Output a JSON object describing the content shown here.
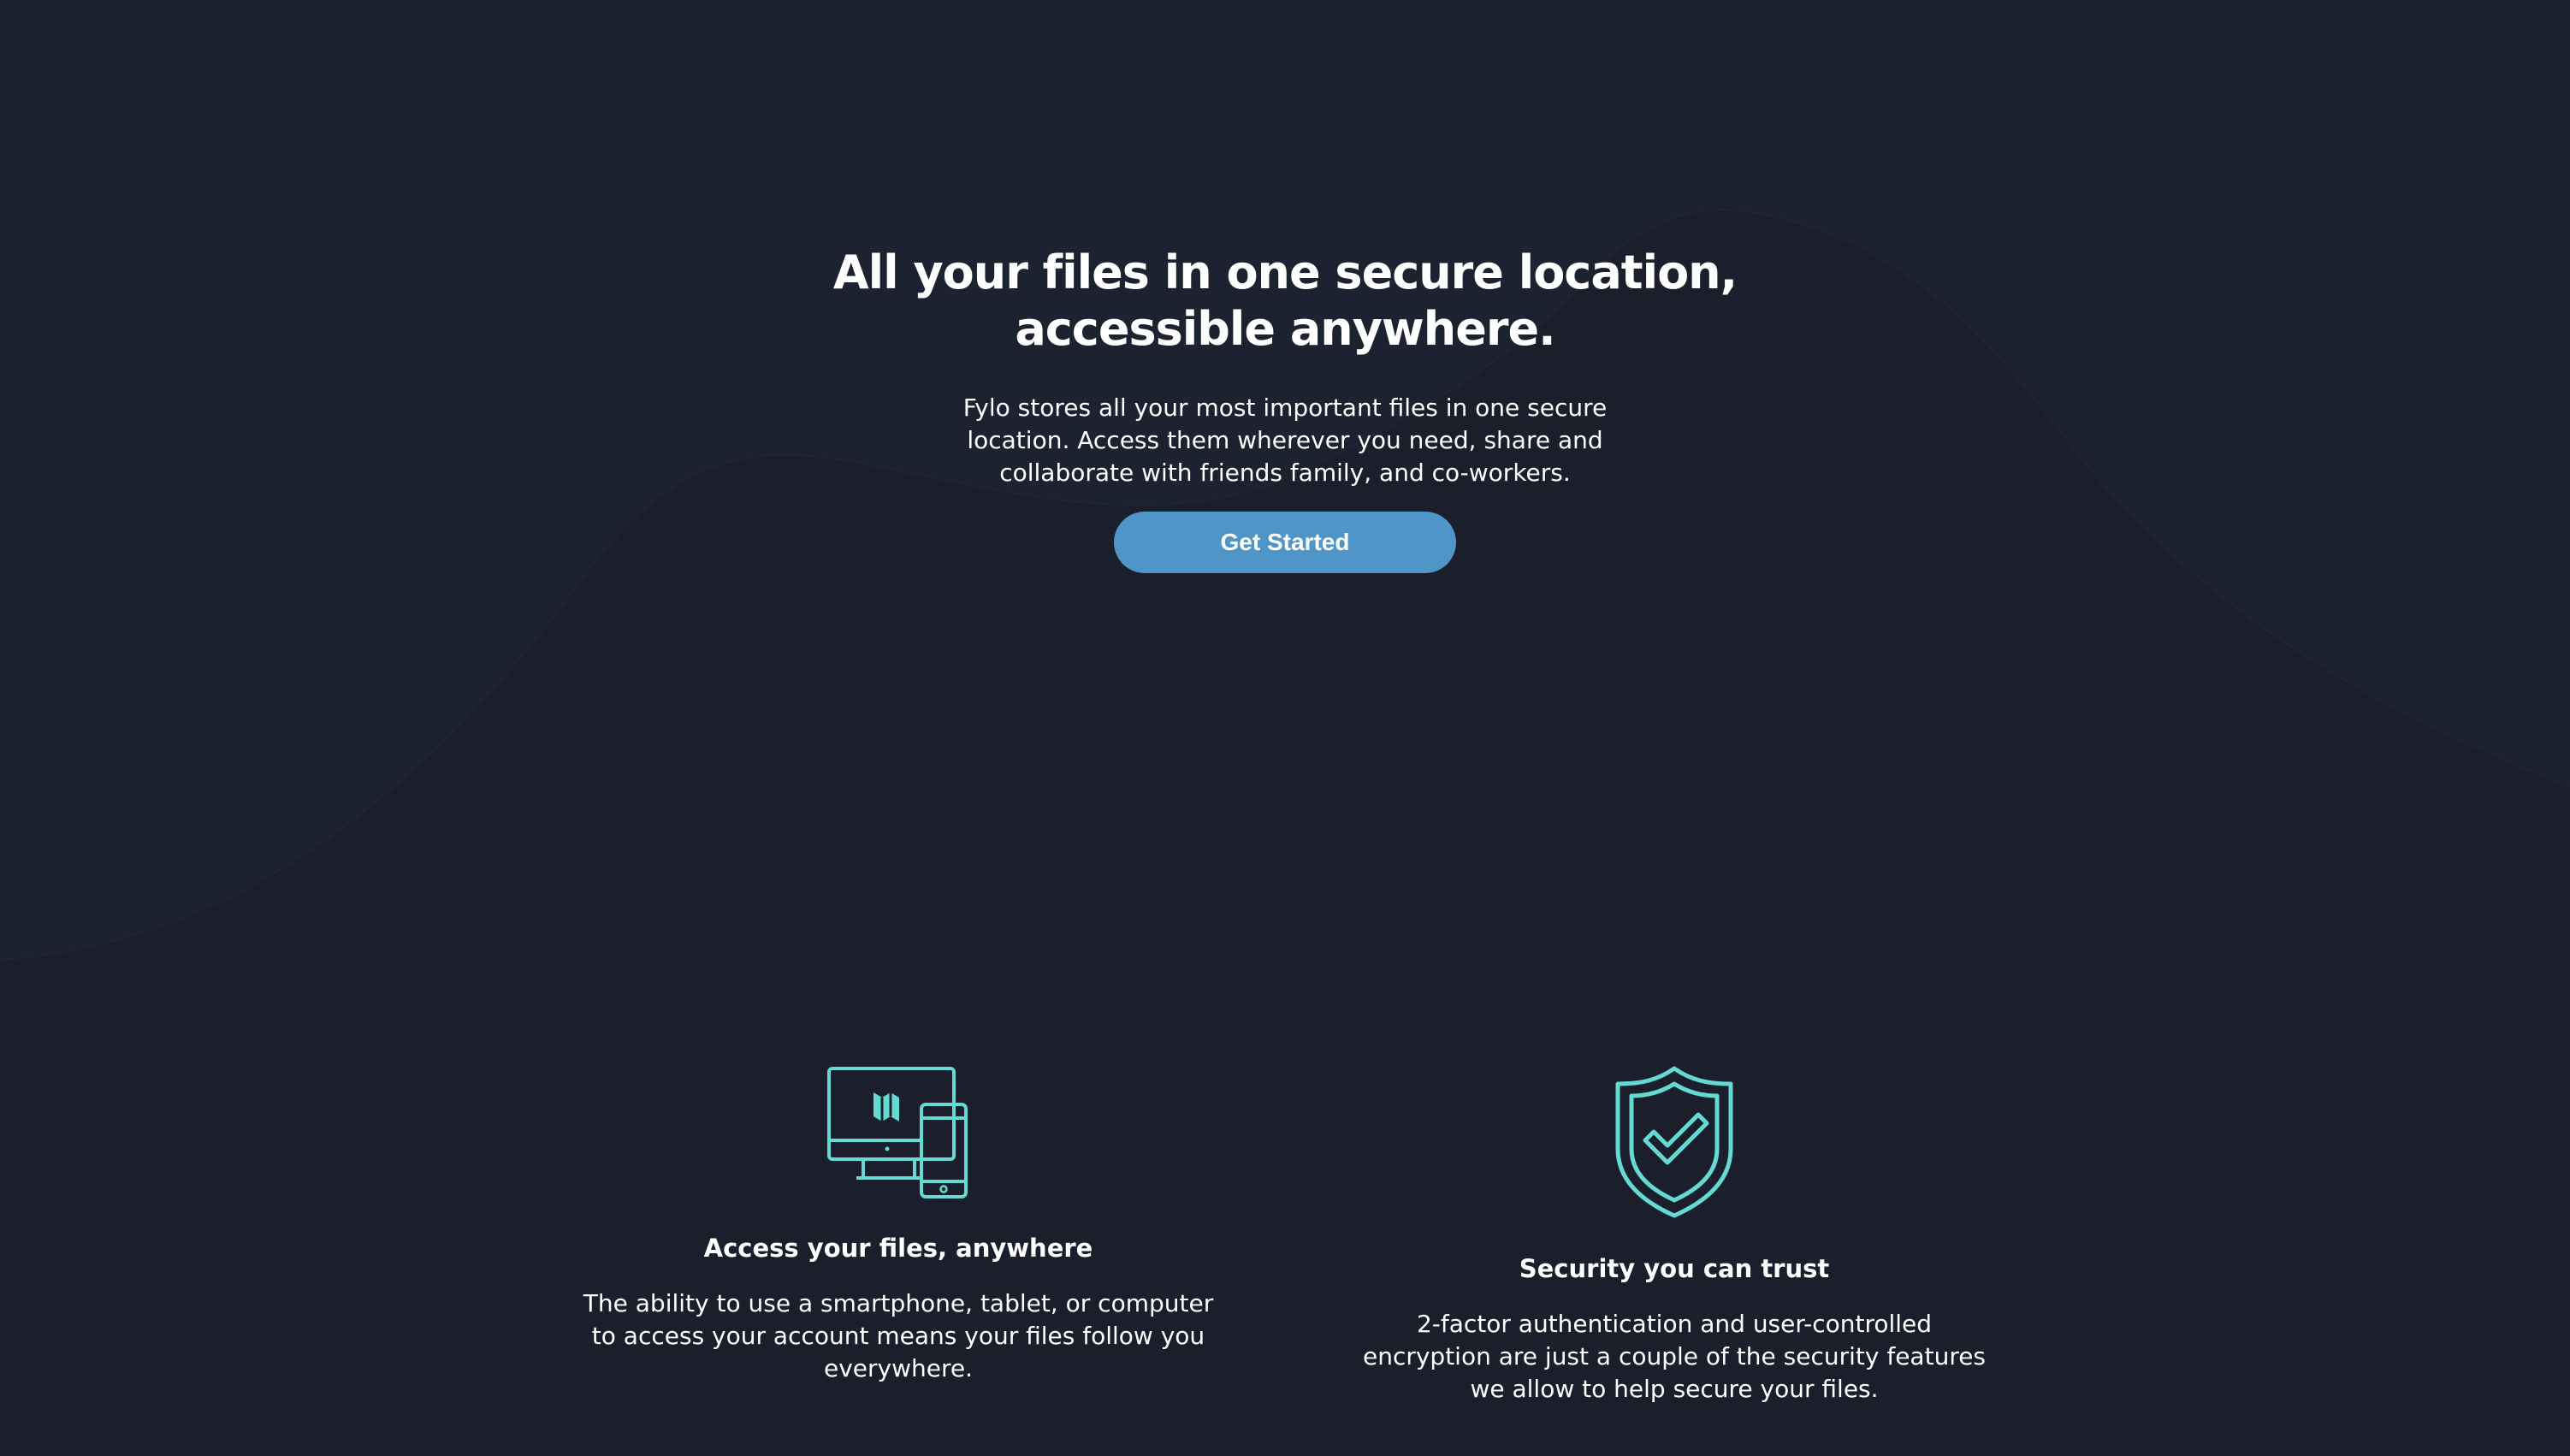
{
  "colors": {
    "background": "#1c2230",
    "curve": "#1f2533",
    "accent_button": "#4f95c7",
    "icon_stroke": "#65dad2",
    "text": "#ffffff"
  },
  "hero": {
    "title_line1": "All your files in one secure location,",
    "title_line2": "accessible anywhere.",
    "description": "Fylo stores all your most important files in one secure location. Access them wherever you need, share and collaborate with friends family, and co-workers.",
    "cta_label": "Get Started"
  },
  "features": [
    {
      "icon": "devices-icon",
      "title": "Access your files, anywhere",
      "description": "The ability to use a smartphone, tablet, or computer to access your account means your files follow you everywhere."
    },
    {
      "icon": "shield-check-icon",
      "title": "Security you can trust",
      "description": "2-factor authentication and user-controlled encryption are just a couple of the security features we allow to help secure your files."
    }
  ]
}
